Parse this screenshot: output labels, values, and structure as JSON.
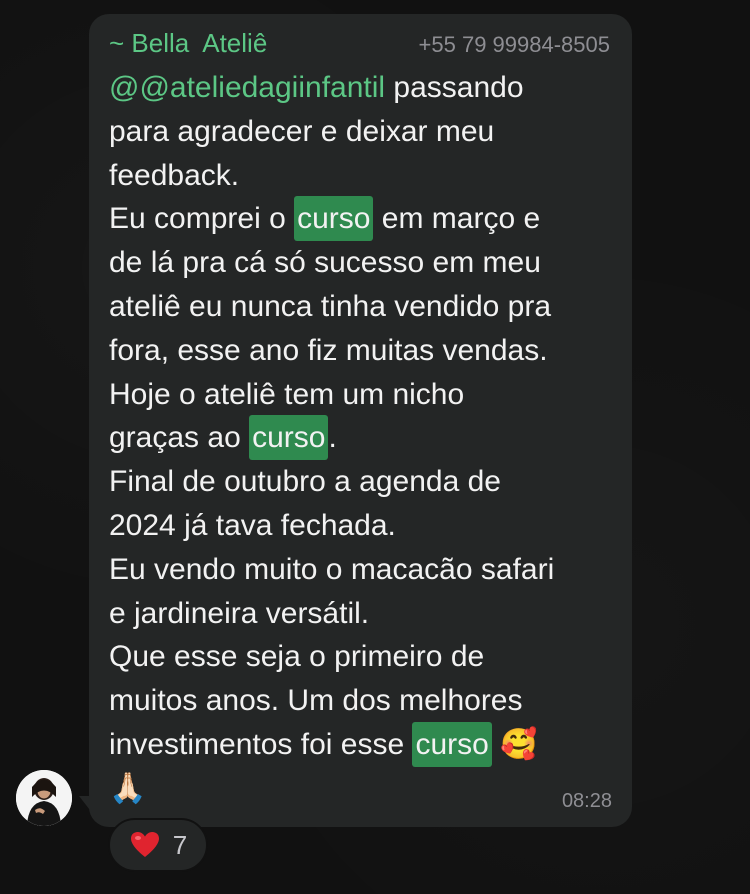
{
  "sender": {
    "name": "~ Bella  Ateliê",
    "phone": "+55 79 99984-8505"
  },
  "message": {
    "mention": "@@ateliedagiinfantil",
    "line_1_rest": " passando",
    "line_2": "para agradecer e deixar meu",
    "line_3": "feedback.",
    "line_4_pre": "Eu comprei o ",
    "highlight_word": "curso",
    "line_4_post": " em março e",
    "line_5": "de lá pra cá só sucesso em meu",
    "line_6": "ateliê eu nunca tinha vendido pra",
    "line_7": "fora, esse ano fiz muitas vendas.",
    "line_8": "Hoje o ateliê tem um nicho",
    "line_9_pre": "graças ao ",
    "line_9_post": ".",
    "line_10": "Final de outubro a agenda de",
    "line_11": "2024  já tava fechada.",
    "line_12": "Eu vendo muito o macacão safari",
    "line_13": "e jardineira versátil.",
    "line_14": "Que esse seja o primeiro de",
    "line_15": "muitos anos. Um dos melhores",
    "line_16_pre": "investimentos foi esse ",
    "emoji_smiling_hearts": "🥰",
    "emoji_praying_hands": "🙏🏻"
  },
  "timestamp": "08:28",
  "reaction": {
    "icon": "red-heart-icon",
    "count": "7",
    "color": "#e0242f"
  },
  "colors": {
    "accent_green": "#5cc785",
    "highlight_bg": "#2f8a4f",
    "bubble_bg": "#242626",
    "page_bg": "#111111"
  }
}
